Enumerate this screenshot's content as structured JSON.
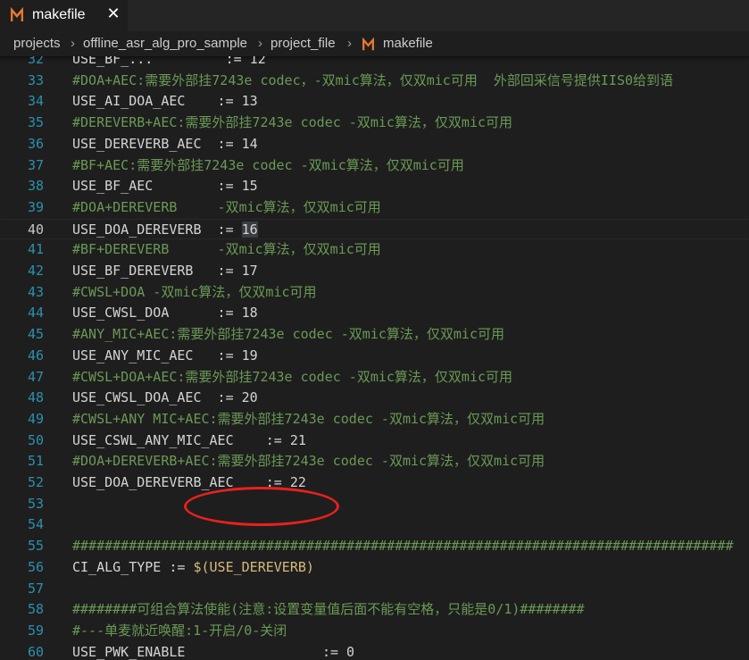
{
  "tab": {
    "title": "makefile",
    "icon": "makefile-m-icon",
    "close_glyph": "✕"
  },
  "breadcrumb": {
    "items": [
      "projects",
      "offline_asr_alg_pro_sample",
      "project_file",
      "makefile"
    ],
    "separator": "›"
  },
  "colors": {
    "background": "#1e1e1e",
    "tab_bar": "#252526",
    "line_number": "#2b91af",
    "comment": "#6a9955",
    "code": "#d4d4d4",
    "makefile_icon": "#e37933",
    "annotation_ellipse": "#e8211d"
  },
  "editor": {
    "lines": [
      {
        "n": "32",
        "text": "USE_BF_...         := 12",
        "type": "code"
      },
      {
        "n": "33",
        "text": "#DOA+AEC:需要外部挂7243e codec，-双mic算法，仅双mic可用  外部回采信号提供IIS0给到语",
        "type": "comment"
      },
      {
        "n": "34",
        "text": "USE_AI_DOA_AEC    := 13",
        "type": "code"
      },
      {
        "n": "35",
        "text": "#DEREVERB+AEC:需要外部挂7243e codec -双mic算法，仅双mic可用",
        "type": "comment"
      },
      {
        "n": "36",
        "text": "USE_DEREVERB_AEC  := 14",
        "type": "code"
      },
      {
        "n": "37",
        "text": "#BF+AEC:需要外部挂7243e codec -双mic算法，仅双mic可用",
        "type": "comment"
      },
      {
        "n": "38",
        "text": "USE_BF_AEC        := 15",
        "type": "code"
      },
      {
        "n": "39",
        "text": "#DOA+DEREVERB     -双mic算法，仅双mic可用",
        "type": "comment"
      },
      {
        "n": "40",
        "text": "USE_DOA_DEREVERB  := ",
        "hl": "16",
        "type": "code",
        "current": true
      },
      {
        "n": "41",
        "text": "#BF+DEREVERB      -双mic算法，仅双mic可用",
        "type": "comment"
      },
      {
        "n": "42",
        "text": "USE_BF_DEREVERB   := 17",
        "type": "code"
      },
      {
        "n": "43",
        "text": "#CWSL+DOA -双mic算法，仅双mic可用",
        "type": "comment"
      },
      {
        "n": "44",
        "text": "USE_CWSL_DOA      := 18",
        "type": "code"
      },
      {
        "n": "45",
        "text": "#ANY_MIC+AEC:需要外部挂7243e codec -双mic算法，仅双mic可用",
        "type": "comment"
      },
      {
        "n": "46",
        "text": "USE_ANY_MIC_AEC   := 19",
        "type": "code"
      },
      {
        "n": "47",
        "text": "#CWSL+DOA+AEC:需要外部挂7243e codec -双mic算法，仅双mic可用",
        "type": "comment"
      },
      {
        "n": "48",
        "text": "USE_CWSL_DOA_AEC  := 20",
        "type": "code"
      },
      {
        "n": "49",
        "text": "#CWSL+ANY MIC+AEC:需要外部挂7243e codec -双mic算法，仅双mic可用",
        "type": "comment"
      },
      {
        "n": "50",
        "text": "USE_CSWL_ANY_MIC_AEC    := 21",
        "type": "code"
      },
      {
        "n": "51",
        "text": "#DOA+DEREVERB+AEC:需要外部挂7243e codec -双mic算法，仅双mic可用",
        "type": "comment"
      },
      {
        "n": "52",
        "text": "USE_DOA_DEREVERB_AEC    := 22",
        "type": "code"
      },
      {
        "n": "53",
        "text": "",
        "type": "code"
      },
      {
        "n": "54",
        "text": "",
        "type": "code"
      },
      {
        "n": "55",
        "text": "##################################################################################",
        "type": "comment"
      },
      {
        "n": "56",
        "text": "CI_ALG_TYPE := ",
        "dollar": "$(USE_DEREVERB)",
        "type": "code"
      },
      {
        "n": "57",
        "text": "",
        "type": "code"
      },
      {
        "n": "58",
        "text": "########可组合算法使能(注意:设置变量值后面不能有空格，只能是0/1)########",
        "type": "comment"
      },
      {
        "n": "59",
        "text": "#---单麦就近唤醒:1-开启/0-关闭",
        "type": "comment"
      },
      {
        "n": "60",
        "text": "USE_PWK_ENABLE                 := 0",
        "type": "code"
      }
    ]
  }
}
